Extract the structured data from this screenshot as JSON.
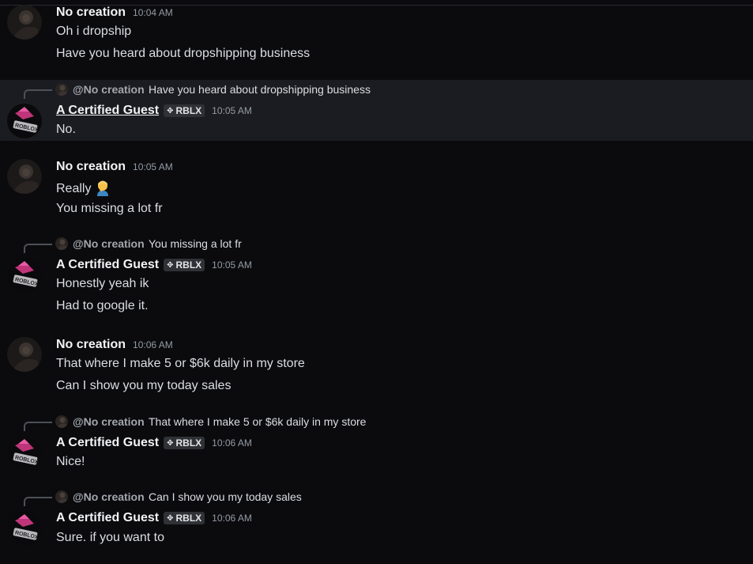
{
  "users": {
    "nocreation": {
      "name": "No creation",
      "mention": "@No creation"
    },
    "guest": {
      "name": "A Certified Guest",
      "tag": "RBLX",
      "tag_icon": "sparkle-icon"
    }
  },
  "messages": [
    {
      "author": "No creation",
      "time": "10:04 AM",
      "lines": [
        "Oh i dropship",
        "Have you heard about dropshipping business"
      ]
    },
    {
      "author": "A Certified Guest",
      "tag": "RBLX",
      "time": "10:05 AM",
      "reply_to": "@No creation",
      "reply_text": "Have you heard about dropshipping business",
      "lines": [
        "No."
      ]
    },
    {
      "author": "No creation",
      "time": "10:05 AM",
      "lines": [
        "Really",
        "You missing a lot fr"
      ],
      "emoji": "person-facepalming"
    },
    {
      "author": "A Certified Guest",
      "tag": "RBLX",
      "time": "10:05 AM",
      "reply_to": "@No creation",
      "reply_text": "You missing a lot fr",
      "lines": [
        "Honestly yeah ik",
        "Had to google it."
      ]
    },
    {
      "author": "No creation",
      "time": "10:06 AM",
      "lines": [
        "That where I make 5 or $6k daily in my store",
        "Can I show you my today sales"
      ]
    },
    {
      "author": "A Certified Guest",
      "tag": "RBLX",
      "time": "10:06 AM",
      "reply_to": "@No creation",
      "reply_text": "That where I make 5 or $6k daily in my store",
      "lines": [
        "Nice!"
      ]
    },
    {
      "author": "A Certified Guest",
      "tag": "RBLX",
      "time": "10:06 AM",
      "reply_to": "@No creation",
      "reply_text": "Can I show you my today sales",
      "lines": [
        "Sure. if you want to"
      ]
    }
  ],
  "colors": {
    "background": "#0b0b0e",
    "highlight": "#1b1c21",
    "muted": "#949ba4"
  }
}
